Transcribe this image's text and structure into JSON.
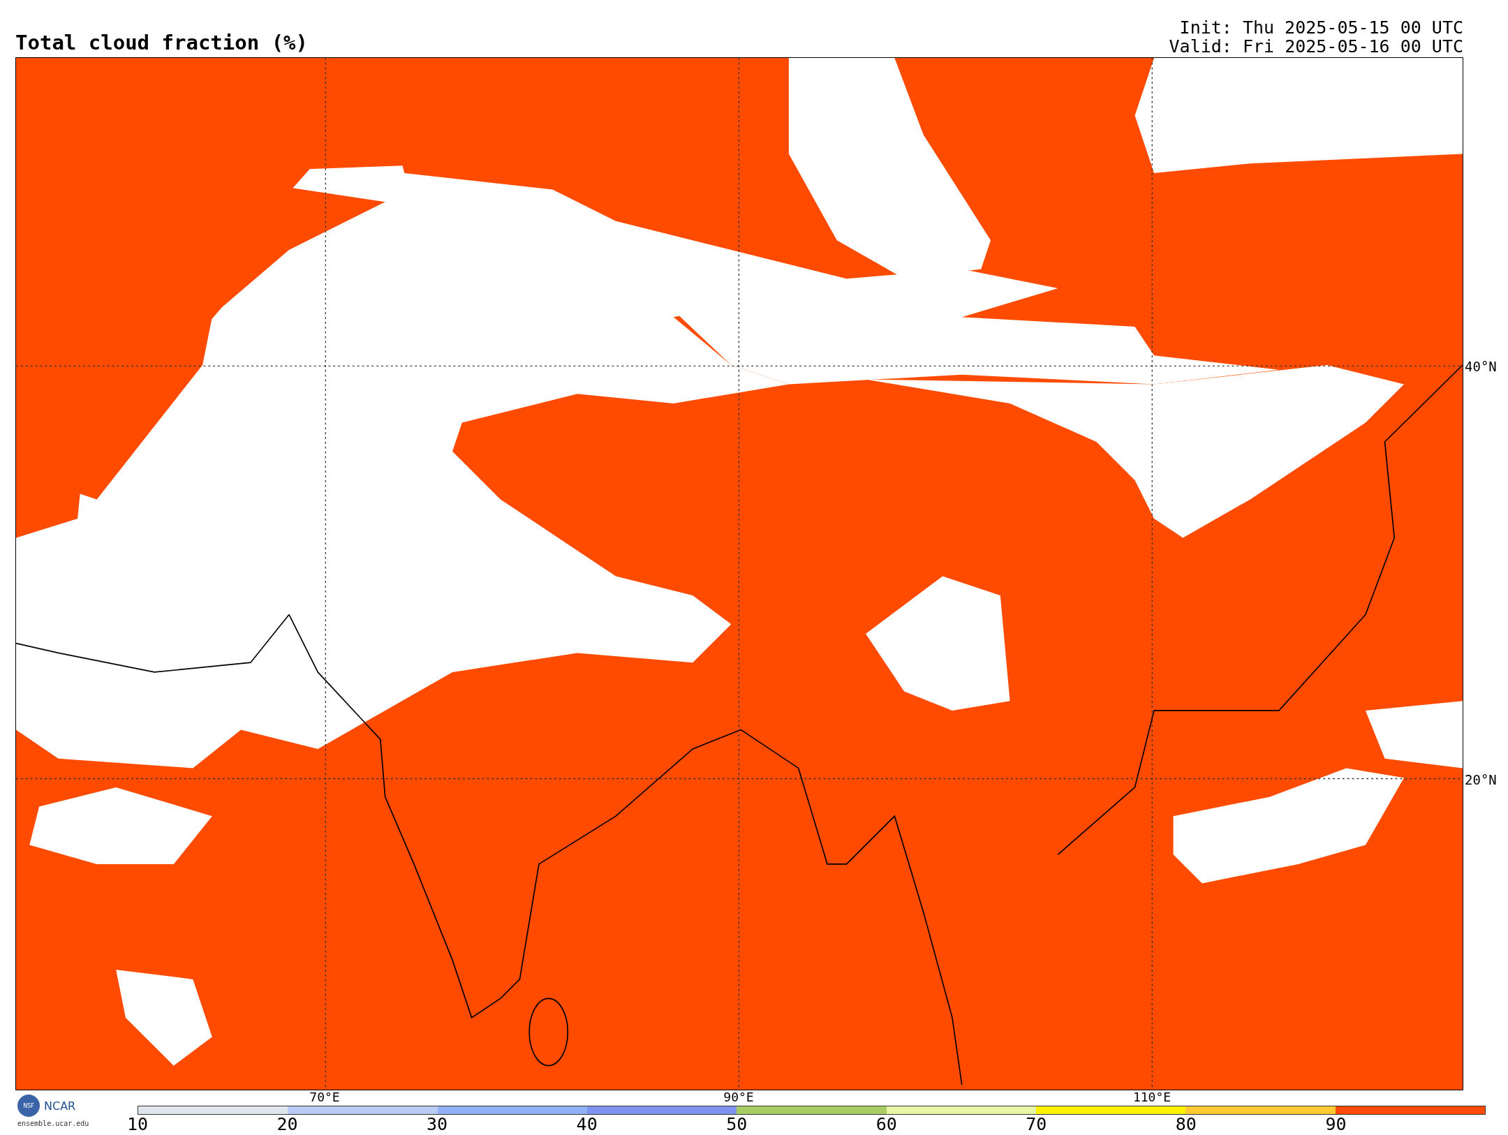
{
  "title": "Total cloud fraction (%)",
  "init": "Init: Thu 2025-05-15 00 UTC",
  "valid": "Valid: Fri 2025-05-16 00 UTC",
  "lat_labels": [
    "40°N",
    "20°N"
  ],
  "lon_labels": [
    "70°E",
    "90°E",
    "110°E"
  ],
  "logo": {
    "seal": "NSF",
    "name": "NCAR",
    "url": "ensemble.ucar.edu"
  },
  "colorbar": {
    "ticks": [
      "10",
      "20",
      "30",
      "40",
      "50",
      "60",
      "70",
      "80",
      "90"
    ],
    "segments": [
      {
        "color": "#dfe6ec"
      },
      {
        "color": "#b8cbf4"
      },
      {
        "color": "#93b2f6"
      },
      {
        "color": "#7e94ef"
      },
      {
        "color": "#a9cd63"
      },
      {
        "color": "#e8f5a4"
      },
      {
        "color": "#fff200"
      },
      {
        "color": "#ffcb33"
      },
      {
        "color": "#ff4b00"
      }
    ]
  }
}
